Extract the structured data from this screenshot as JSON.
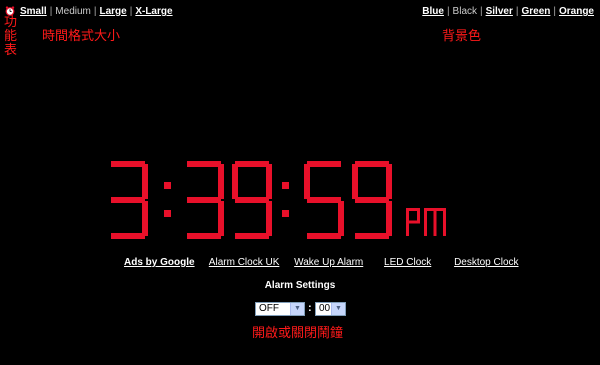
{
  "size_links": {
    "items": [
      "Small",
      "Medium",
      "Large",
      "X-Large"
    ],
    "current": "Medium"
  },
  "color_links": {
    "items": [
      "Blue",
      "Black",
      "Silver",
      "Green",
      "Orange"
    ],
    "current": "Black"
  },
  "annotations": {
    "menu": "功能表",
    "time_format": "時間格式大小",
    "background": "背景色",
    "alarm": "開啟或關閉鬧鐘"
  },
  "clock": {
    "hours": "3",
    "minutes": "39",
    "seconds": "59",
    "ampm": "PM",
    "color": "#e8102a"
  },
  "ad_links": [
    "Ads by Google",
    "Alarm Clock UK",
    "Wake Up Alarm",
    "LED Clock",
    "Desktop Clock"
  ],
  "alarm": {
    "title": "Alarm Settings",
    "hour_value": "OFF",
    "minute_value": "00",
    "separator": ":"
  },
  "icons": {
    "menu_icon": "alarm-clock-icon",
    "dropdown_icon": "chevron-down-icon"
  },
  "colors": {
    "background": "#000000",
    "annotation": "#ff1a1a",
    "digits": "#e8102a"
  }
}
